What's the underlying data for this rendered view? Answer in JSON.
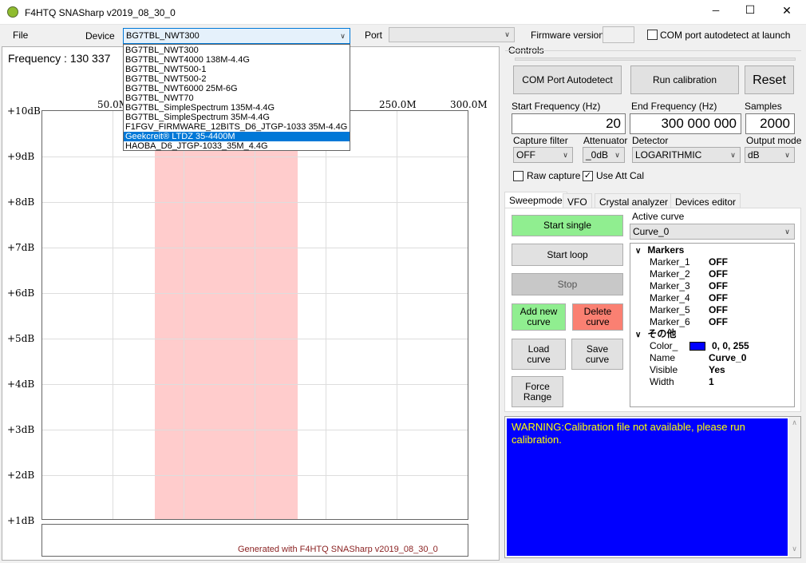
{
  "window": {
    "title": "F4HTQ SNASharp v2019_08_30_0",
    "minimize": "─",
    "maximize": "☐",
    "close": "✕"
  },
  "menu": {
    "file": "File",
    "device_label": "Device",
    "device_value": "BG7TBL_NWT300",
    "port_label": "Port",
    "firmware_label": "Firmware version",
    "autodetect_label": "COM port autodetect at launch"
  },
  "device_list": [
    "BG7TBL_NWT300",
    "BG7TBL_NWT4000 138M-4.4G",
    "BG7TBL_NWT500-1",
    "BG7TBL_NWT500-2",
    "BG7TBL_NWT6000 25M-6G",
    "BG7TBL_NWT70",
    "BG7TBL_SimpleSpectrum 135M-4.4G",
    "BG7TBL_SimpleSpectrum 35M-4.4G",
    "F1FGV_FIRMWARE_12BITS_D6_JTGP-1033 35M-4.4G",
    "Geekcreit® LTDZ 35-4400M",
    "HAOBA_D6_JTGP-1033_35M_4.4G"
  ],
  "graph": {
    "frequency_text": "Frequency : 130 337",
    "y_labels": [
      "+10dB",
      "+9dB",
      "+8dB",
      "+7dB",
      "+6dB",
      "+5dB",
      "+4dB",
      "+3dB",
      "+2dB",
      "+1dB"
    ],
    "x_labels": [
      "50.0M",
      "250.0M",
      "300.0M"
    ],
    "footer": "Generated with F4HTQ SNASharp v2019_08_30_0"
  },
  "controls": {
    "group_label": "Controls",
    "com_autodetect": "COM Port Autodetect",
    "run_calibration": "Run calibration",
    "reset": "Reset",
    "start_freq_label": "Start Frequency (Hz)",
    "start_freq_value": "20",
    "end_freq_label": "End Frequency (Hz)",
    "end_freq_value": "300 000 000",
    "samples_label": "Samples",
    "samples_value": "2000",
    "capture_filter_label": "Capture filter",
    "capture_filter_value": "OFF",
    "attenuator_label": "Attenuator",
    "attenuator_value": "_0dB",
    "detector_label": "Detector",
    "detector_value": "LOGARITHMIC",
    "output_mode_label": "Output mode",
    "output_mode_value": "dB",
    "raw_capture_label": "Raw capture",
    "use_att_cal_label": "Use Att Cal"
  },
  "tabs": [
    "Sweepmode",
    "VFO",
    "Crystal analyzer",
    "Devices editor"
  ],
  "sweep": {
    "start_single": "Start single",
    "start_loop": "Start loop",
    "stop": "Stop",
    "add_curve": "Add new curve",
    "delete_curve": "Delete curve",
    "load_curve": "Load curve",
    "save_curve": "Save curve",
    "force_range": "Force Range",
    "active_curve_label": "Active curve",
    "active_curve_value": "Curve_0"
  },
  "properties": {
    "markers_label": "Markers",
    "markers": [
      {
        "name": "Marker_1",
        "value": "OFF"
      },
      {
        "name": "Marker_2",
        "value": "OFF"
      },
      {
        "name": "Marker_3",
        "value": "OFF"
      },
      {
        "name": "Marker_4",
        "value": "OFF"
      },
      {
        "name": "Marker_5",
        "value": "OFF"
      },
      {
        "name": "Marker_6",
        "value": "OFF"
      }
    ],
    "other_label": "その他",
    "color_name": "Color_",
    "color_value": "0, 0, 255",
    "name_name": "Name",
    "name_value": "Curve_0",
    "visible_name": "Visible",
    "visible_value": "Yes",
    "width_name": "Width",
    "width_value": "1"
  },
  "log": {
    "text": "WARNING:Calibration file not available, please run calibration."
  },
  "colors": {
    "accent": "#0078d7",
    "green": "#90ee90",
    "red": "#fa8072",
    "band": "#ffcccc",
    "log_bg": "#0000ff",
    "log_fg": "#ffff00"
  }
}
